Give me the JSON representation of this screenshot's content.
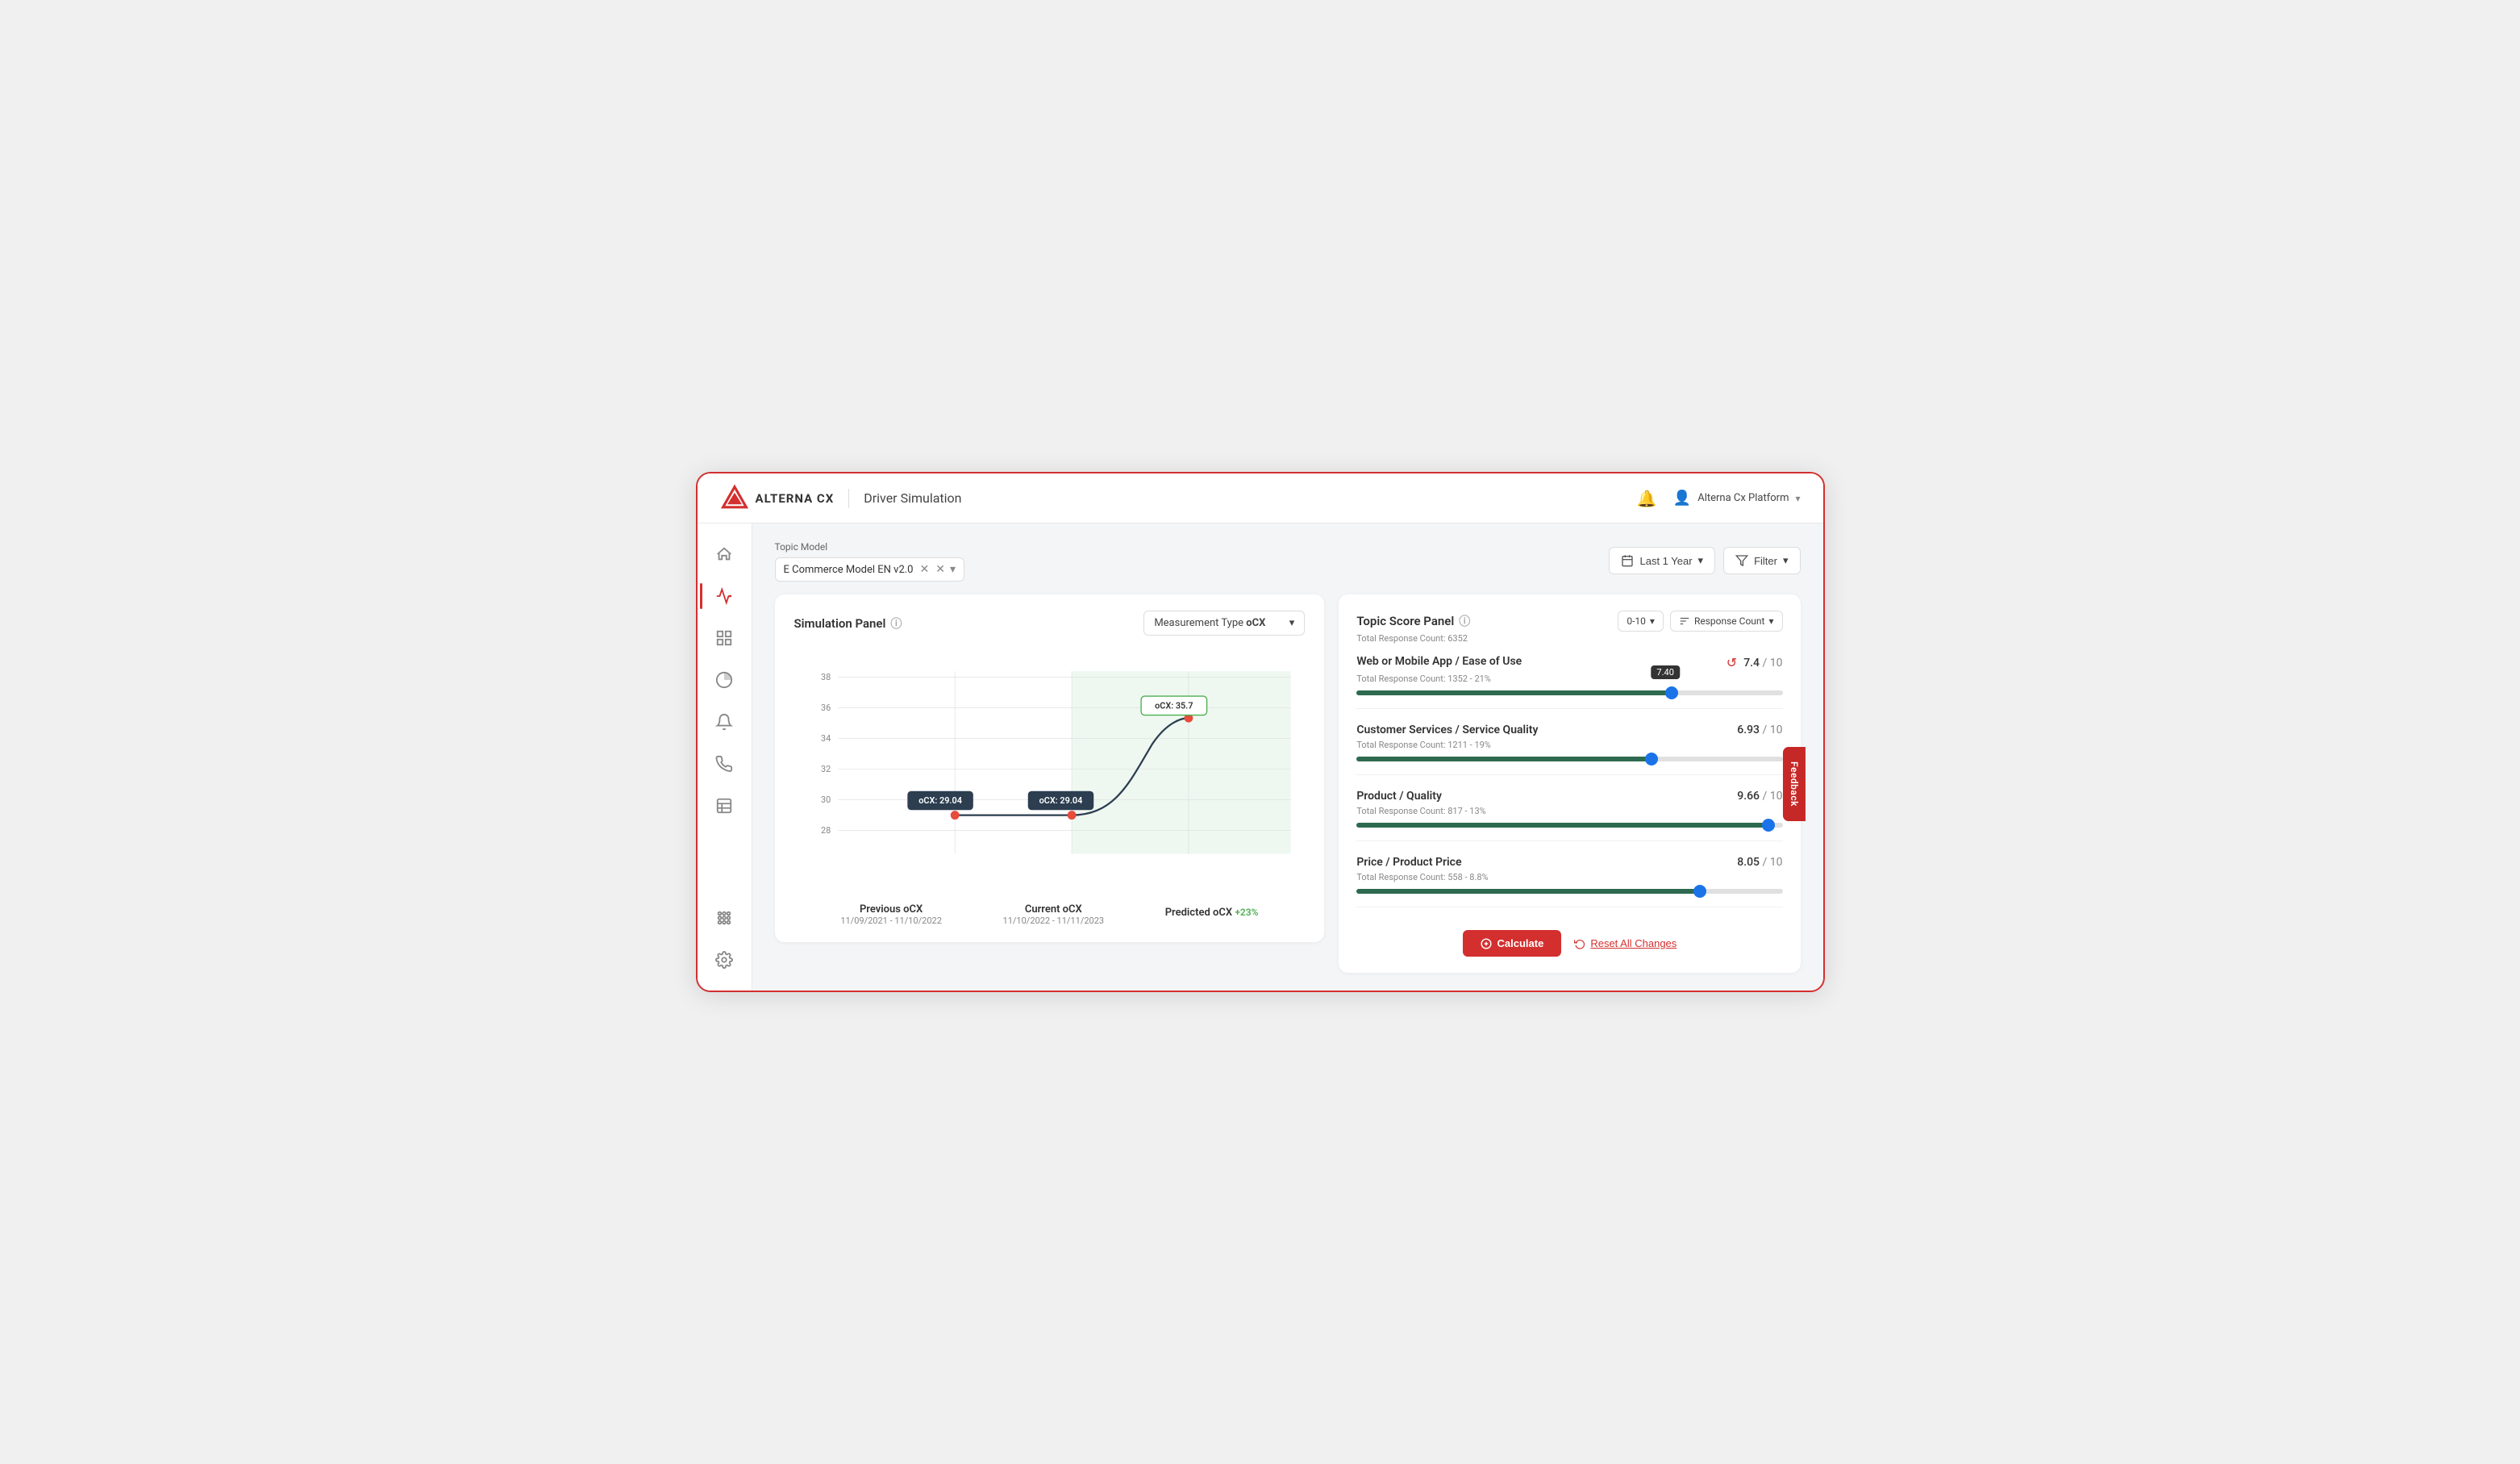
{
  "app": {
    "name": "ALTERNA CX",
    "page_title": "Driver Simulation"
  },
  "header": {
    "bell_label": "🔔",
    "user_icon": "👤",
    "user_name": "Alterna Cx Platform",
    "chevron": "▾"
  },
  "sidebar": {
    "items": [
      {
        "id": "home",
        "icon": "⌂",
        "label": "Home"
      },
      {
        "id": "analytics",
        "icon": "📈",
        "label": "Analytics",
        "active": true
      },
      {
        "id": "grid",
        "icon": "⊞",
        "label": "Grid"
      },
      {
        "id": "chart",
        "icon": "◑",
        "label": "Chart"
      },
      {
        "id": "bell",
        "icon": "🔔",
        "label": "Notifications"
      },
      {
        "id": "phone",
        "icon": "📞",
        "label": "Phone"
      },
      {
        "id": "table",
        "icon": "▦",
        "label": "Table"
      },
      {
        "id": "apps",
        "icon": "⋯",
        "label": "Apps"
      },
      {
        "id": "settings",
        "icon": "⚙",
        "label": "Settings"
      }
    ]
  },
  "topic_bar": {
    "label": "Topic Model",
    "tag_text": "E Commerce Model EN v2.0",
    "date_filter": "Last 1 Year",
    "filter_label": "Filter"
  },
  "simulation_panel": {
    "title": "Simulation Panel",
    "measurement_label": "Measurement Type",
    "measurement_value": "oCX",
    "chart": {
      "y_labels": [
        "38",
        "36",
        "34",
        "32",
        "30",
        "28"
      ],
      "y_values": [
        38,
        36,
        34,
        32,
        30,
        28
      ],
      "points": [
        {
          "label": "Previous oCX",
          "date": "11/09/2021 - 11/10/2022",
          "value": 29.04,
          "x_pct": 25
        },
        {
          "label": "Current oCX",
          "date": "11/10/2022 - 11/11/2023",
          "value": 29.04,
          "x_pct": 50
        },
        {
          "label": "Predicted oCX",
          "date": "",
          "value": 35.7,
          "x_pct": 78,
          "change": "+23%"
        }
      ],
      "tooltip_prev": "oCX: 29.04",
      "tooltip_curr": "oCX: 29.04",
      "tooltip_pred": "oCX: 35.7"
    }
  },
  "score_panel": {
    "title": "Topic Score Panel",
    "total_count_label": "Total Response Count: 6352",
    "range": "0-10",
    "sort_by": "Response Count",
    "drivers": [
      {
        "name": "Web or Mobile App / Ease of Use",
        "count": "1352 - 21%",
        "score": "7.4",
        "score_suffix": "/ 10",
        "slider_value": 7.4,
        "tooltip_value": "7.40",
        "has_refresh": true
      },
      {
        "name": "Customer Services / Service Quality",
        "count": "1211 - 19%",
        "score": "6.93",
        "score_suffix": "/ 10",
        "slider_value": 6.93,
        "has_refresh": false
      },
      {
        "name": "Product / Quality",
        "count": "817 - 13%",
        "score": "9.66",
        "score_suffix": "/ 10",
        "slider_value": 9.66,
        "has_refresh": false
      },
      {
        "name": "Price / Product Price",
        "count": "558 - 8.8%",
        "score": "8.05",
        "score_suffix": "/ 10",
        "slider_value": 8.05,
        "has_refresh": false
      }
    ],
    "calculate_btn": "Calculate",
    "reset_btn": "Reset All Changes"
  },
  "feedback_tab": "Feedback"
}
